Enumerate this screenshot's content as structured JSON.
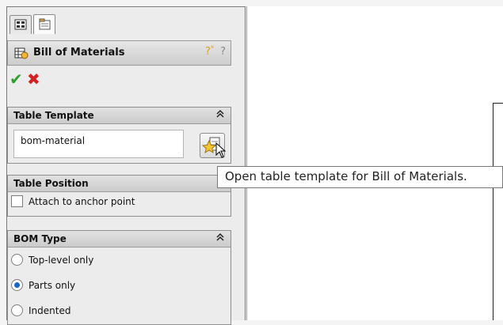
{
  "tabs": [
    {
      "name": "feature-manager",
      "icon": "feature-manager-icon"
    },
    {
      "name": "property-manager",
      "icon": "property-manager-icon"
    }
  ],
  "property_manager": {
    "title": "Bill of Materials",
    "icon": "bom-icon",
    "help_icons": [
      "whats-wrong-icon",
      "help-icon"
    ],
    "ok_glyph": "✔",
    "cancel_glyph": "✖"
  },
  "table_template": {
    "title": "Table Template",
    "collapse_glyph": "≈",
    "value": "bom-material",
    "button_icon": "open-table-template-icon"
  },
  "table_position": {
    "title": "Table Position",
    "anchor_label": "Attach to anchor point",
    "anchor_checked": false
  },
  "bom_type": {
    "title": "BOM Type",
    "collapse_glyph": "≈",
    "options": [
      {
        "label": "Top-level only",
        "checked": false
      },
      {
        "label": "Parts only",
        "checked": true
      },
      {
        "label": "Indented",
        "checked": false
      }
    ]
  },
  "tooltip": {
    "text": "Open table template for Bill of Materials."
  },
  "colors": {
    "ok": "#2e9e2e",
    "cancel": "#d42020",
    "radio_selected": "#1f64c8"
  }
}
